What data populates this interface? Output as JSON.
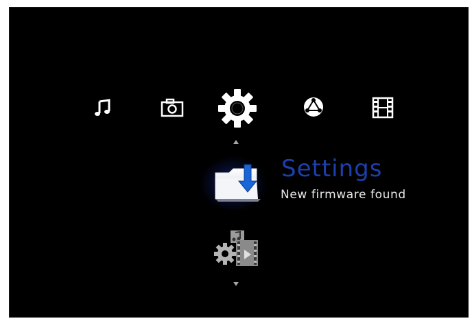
{
  "categories": [
    {
      "name": "music-icon",
      "selected": false
    },
    {
      "name": "photo-icon",
      "selected": false
    },
    {
      "name": "settings-icon",
      "selected": true
    },
    {
      "name": "network-icon",
      "selected": false
    },
    {
      "name": "video-icon",
      "selected": false
    }
  ],
  "submenu": {
    "selected_item": {
      "icon": "firmware-update-icon",
      "title": "Settings",
      "subtitle": "New firmware found"
    },
    "next_item": {
      "icon": "media-settings-icon"
    }
  },
  "colors": {
    "background": "#000000",
    "title": "#1c3fae",
    "subtitle": "#e8e8e8",
    "icon": "#ffffff",
    "folder_arrow": "#1a66d8"
  }
}
